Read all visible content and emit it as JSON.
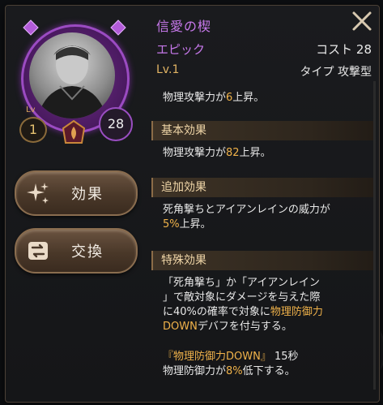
{
  "item": {
    "name": "信愛の楔",
    "rarity": "エピック",
    "cost_label": "コスト 28",
    "level_label": "Lv.1",
    "type_label": "タイプ 攻撃型"
  },
  "portrait": {
    "lv_small": "Lv",
    "lv_value": "1",
    "cost_value": "28"
  },
  "buttons": {
    "effect": "効果",
    "exchange": "交換"
  },
  "stats": {
    "line1_pre": "物理攻撃力が",
    "line1_val": "6",
    "line1_post": "上昇。"
  },
  "sections": {
    "basic_title": "基本効果",
    "basic_pre": "物理攻撃力が",
    "basic_val": "82",
    "basic_post": "上昇。",
    "extra_title": "追加効果",
    "extra_line1": "死角撃ちとアイアンレインの威力が",
    "extra_val": "5%",
    "extra_post": "上昇。",
    "special_title": "特殊効果",
    "special_line1": "「死角撃ち」か「アイアンレイン",
    "special_line2": "」で敵対象にダメージを与えた際",
    "special_line3_pre": "に40%の確率で対象に",
    "special_line3_hl": "物理防御力",
    "special_line4_hl": "DOWN",
    "special_line4_post": "デバフを付与する。",
    "debuff_name": "『物理防御力DOWN』",
    "debuff_duration": " 15秒",
    "debuff_line_pre": "物理防御力が",
    "debuff_val": "8%",
    "debuff_line_post": "低下する。"
  },
  "colors": {
    "accent_purple": "#c678ea",
    "highlight_gold": "#f0b24a",
    "level_gold": "#e2b464"
  }
}
